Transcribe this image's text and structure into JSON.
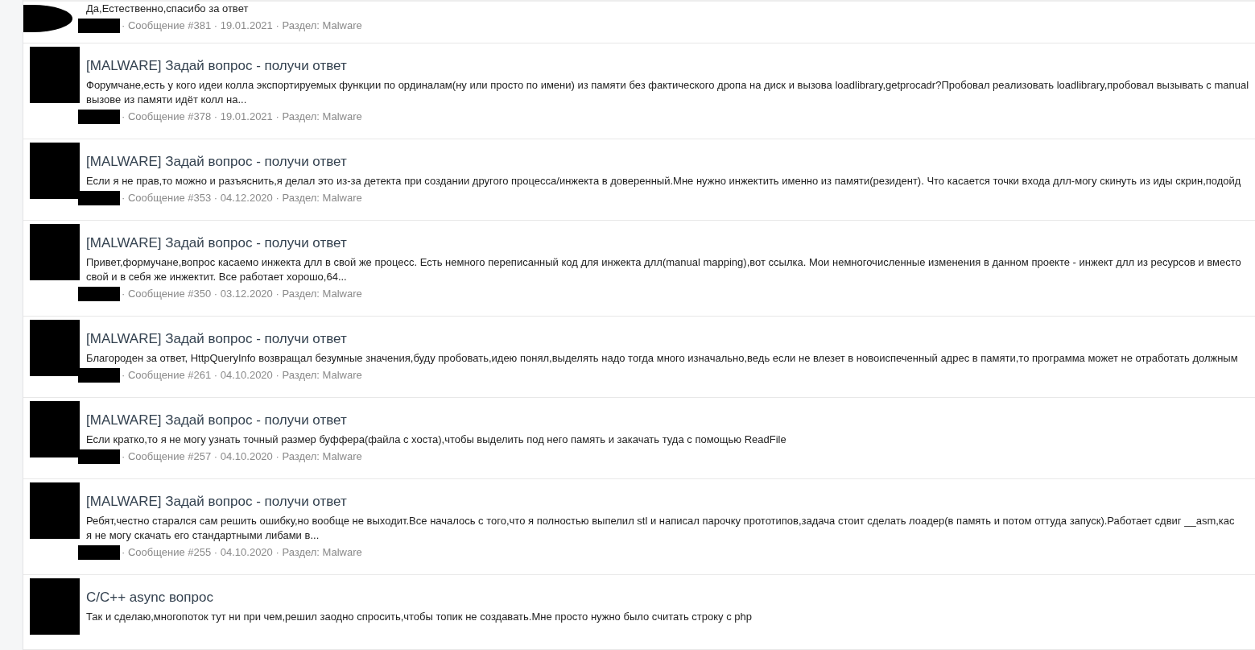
{
  "results": [
    {
      "snippet": [
        "Да,Естественно,спасибо за ответ"
      ],
      "meta": "· Сообщение #381 · 19.01.2021 · Раздел: Malware"
    },
    {
      "title": "[MALWARE] Задай вопрос - получи ответ",
      "snippet": [
        "Форумчане,есть у кого идеи колла экспортируемых функции по ординалам(ну или просто по имени) из памяти без фактического дропа на диск и вызова loadlibrary,getprocadr?Пробовал реализовать loadlibrary,пробовал вызывать с manual",
        "вызове из памяти идёт колл на..."
      ],
      "meta": "· Сообщение #378 · 19.01.2021 · Раздел: Malware"
    },
    {
      "title": "[MALWARE] Задай вопрос - получи ответ",
      "snippet": [
        "Если я не прав,то можно и разъяснить,я делал это из-за детекта при создании другого процесса/инжекта в доверенный.Мне нужно инжектить именно из памяти(резидент). Что касается точки входа длл-могу скинуть из иды скрин,подойд"
      ],
      "meta": "· Сообщение #353 · 04.12.2020 · Раздел: Malware"
    },
    {
      "title": "[MALWARE] Задай вопрос - получи ответ",
      "snippet": [
        "Привет,формучане,вопрос касаемо инжекта длл в свой же процесс. Есть немного переписанный код для инжекта длл(manual mapping),вот ссылка. Мои немногочисленные изменения в данном проекте - инжект длл из ресурсов и вместо",
        "свой и в себя же инжектит. Все работает хорошо,64..."
      ],
      "meta": "· Сообщение #350 · 03.12.2020 · Раздел: Malware"
    },
    {
      "title": "[MALWARE] Задай вопрос - получи ответ",
      "snippet": [
        "Благороден за ответ, HttpQueryInfo возвращал безумные значения,буду пробовать,идею понял,выделять надо тогда много изначально,ведь если не влезет в новоиспеченный адрес в памяти,то программа может не отработать должным"
      ],
      "meta": "· Сообщение #261 · 04.10.2020 · Раздел: Malware"
    },
    {
      "title": "[MALWARE] Задай вопрос - получи ответ",
      "snippet": [
        "Если кратко,то я не могу узнать точный размер буффера(файла с хоста),чтобы выделить под него память и закачать туда с помощью ReadFile"
      ],
      "meta": "· Сообщение #257 · 04.10.2020 · Раздел: Malware"
    },
    {
      "title": "[MALWARE] Задай вопрос - получи ответ",
      "snippet": [
        "Ребят,честно старался сам решить ошибку,но вообще не выходит.Все началось с того,что я полностью выпелил stl и написал парочку прототипов,задача стоит сделать лоадер(в память и потом оттуда запуск).Работает сдвиг __asm,кас",
        "я не могу скачать его стандартными либами в..."
      ],
      "meta": "· Сообщение #255 · 04.10.2020 · Раздел: Malware"
    },
    {
      "title": "C/C++ async вопрос",
      "snippet": [
        "Так и сделаю,многопоток тут ни при чем,решил заодно спросить,чтобы топик не создавать.Мне просто нужно было считать строку с php"
      ]
    }
  ]
}
